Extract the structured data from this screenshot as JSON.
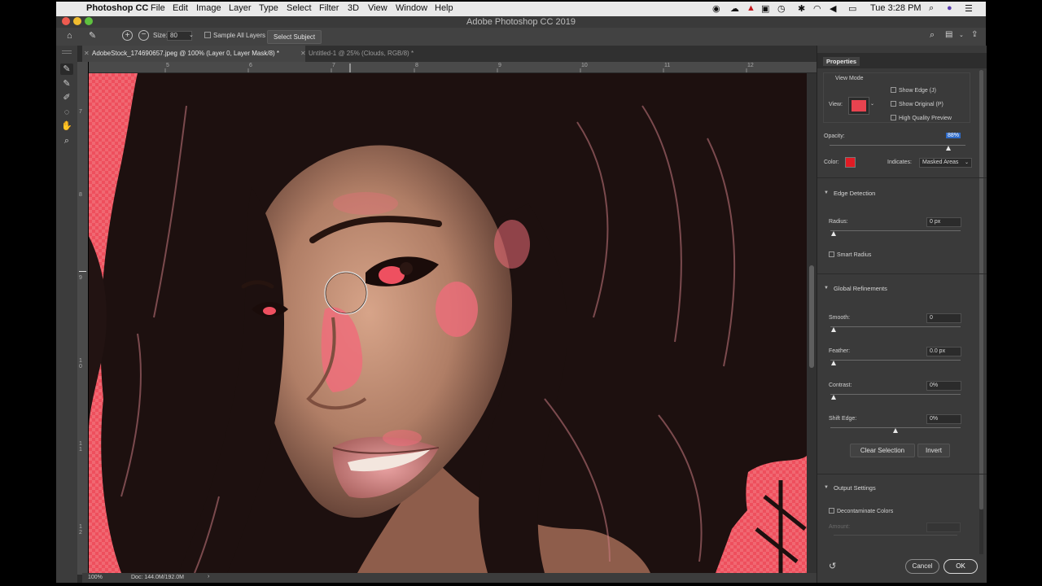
{
  "menubar": {
    "app": "Photoshop CC",
    "items": [
      "File",
      "Edit",
      "Image",
      "Layer",
      "Type",
      "Select",
      "Filter",
      "3D",
      "View",
      "Window",
      "Help"
    ],
    "clock": "Tue 3:28 PM"
  },
  "window": {
    "title": "Adobe Photoshop CC 2019"
  },
  "options": {
    "size_label": "Size:",
    "size_value": "80",
    "sample_all_layers": "Sample All Layers",
    "select_subject": "Select Subject"
  },
  "tabs": [
    {
      "label": "AdobeStock_174690657.jpeg @ 100% (Layer 0, Layer Mask/8) *",
      "active": true
    },
    {
      "label": "Untitled-1 @ 25% (Clouds, RGB/8) *",
      "active": false
    }
  ],
  "ruler": {
    "h": [
      "5",
      "6",
      "7",
      "8",
      "9",
      "10",
      "11",
      "12"
    ],
    "v": [
      "7",
      "8",
      "9",
      "1 0",
      "1 1",
      "1 2"
    ]
  },
  "status": {
    "zoom": "100%",
    "doc": "Doc: 144.0M/192.0M"
  },
  "properties": {
    "title": "Properties",
    "view_mode": {
      "heading": "View Mode",
      "view_label": "View:",
      "show_edge": "Show Edge (J)",
      "show_original": "Show Original (P)",
      "high_quality_preview": "High Quality Preview"
    },
    "opacity": {
      "label": "Opacity:",
      "value": "88%",
      "fraction": 0.88
    },
    "color": {
      "label": "Color:",
      "swatch": "#e01b24"
    },
    "indicates": {
      "label": "Indicates:",
      "value": "Masked Areas"
    },
    "edge_detection": {
      "heading": "Edge Detection",
      "radius_label": "Radius:",
      "radius_value": "0 px",
      "radius_fraction": 0,
      "smart_radius": "Smart Radius"
    },
    "global_refinements": {
      "heading": "Global Refinements",
      "smooth_label": "Smooth:",
      "smooth_value": "0",
      "smooth_fraction": 0,
      "feather_label": "Feather:",
      "feather_value": "0.0 px",
      "feather_fraction": 0,
      "contrast_label": "Contrast:",
      "contrast_value": "0%",
      "contrast_fraction": 0,
      "shift_label": "Shift Edge:",
      "shift_value": "0%",
      "shift_fraction": 0.5
    },
    "clear_selection": "Clear Selection",
    "invert": "Invert",
    "output_settings": {
      "heading": "Output Settings",
      "decontaminate": "Decontaminate Colors",
      "amount_label": "Amount:"
    },
    "cancel": "Cancel",
    "ok": "OK"
  }
}
